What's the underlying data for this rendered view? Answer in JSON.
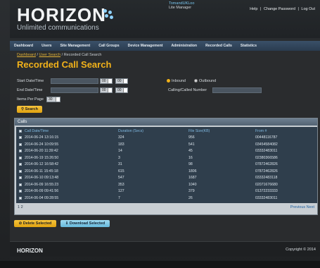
{
  "header": {
    "logo": "HORIZON",
    "tagline": "Unlimited communications",
    "user_name": "TomandUKLoo",
    "user_role": "Lite Manager",
    "links": [
      "Help",
      "|",
      "Change Password",
      "|",
      "Log Out"
    ]
  },
  "nav": {
    "items": [
      "Dashboard",
      "Users",
      "Site Management",
      "Call Groups",
      "Device Management",
      "Administration",
      "Recorded Calls",
      "Statistics"
    ]
  },
  "breadcrumb": {
    "link1": "Dashboard",
    "sep1": " / ",
    "link2": "User Search",
    "sep2": " / ",
    "current": "Recorded Call Search"
  },
  "page_title": "Recorded Call Search",
  "form": {
    "start_label": "Start Date/Time",
    "end_label": "End Date/Time",
    "items_label": "Items Per Page",
    "start_hour": "00",
    "start_min": "00",
    "end_hour": "00",
    "end_min": "00",
    "items_value": "30",
    "inbound_label": "Inbound",
    "outbound_label": "Outbound",
    "calling_label": "Calling/Called Number",
    "search_label": "Search"
  },
  "calls": {
    "title": "Calls",
    "columns": [
      "Call Date/Time",
      "Duration (Secs)",
      "File Size(KB)",
      "From #"
    ],
    "rows": [
      [
        "2014-06-24 13:16:15",
        "324",
        "956",
        "00448116787"
      ],
      [
        "2014-06-24 10:09:55",
        "183",
        "541",
        "03454584082"
      ],
      [
        "2014-06-20 11:39:42",
        "14",
        "45",
        "03332483011"
      ],
      [
        "2014-06-19 15:26:50",
        "3",
        "16",
        "02380366586"
      ],
      [
        "2014-06-12 16:58:42",
        "31",
        "98",
        "07872462826"
      ],
      [
        "2014-06-11 15:45:18",
        "615",
        "1806",
        "07872462826"
      ],
      [
        "2014-06-10 09:13:48",
        "547",
        "1687",
        "03332483118"
      ],
      [
        "2014-06-09 16:55:23",
        "353",
        "1040",
        "02071676680"
      ],
      [
        "2014-06-09 09:41:56",
        "127",
        "379",
        "01372233333"
      ],
      [
        "2014-06-04 09:28:55",
        "7",
        "26",
        "03332483011"
      ]
    ],
    "pager": "1 2",
    "prev_next": "Previous Next"
  },
  "actions": {
    "delete_label": "Delete Selected",
    "download_label": "Download Selected"
  },
  "footer": {
    "logo": "HORIZON",
    "copyright": "Copyright © 2014"
  }
}
